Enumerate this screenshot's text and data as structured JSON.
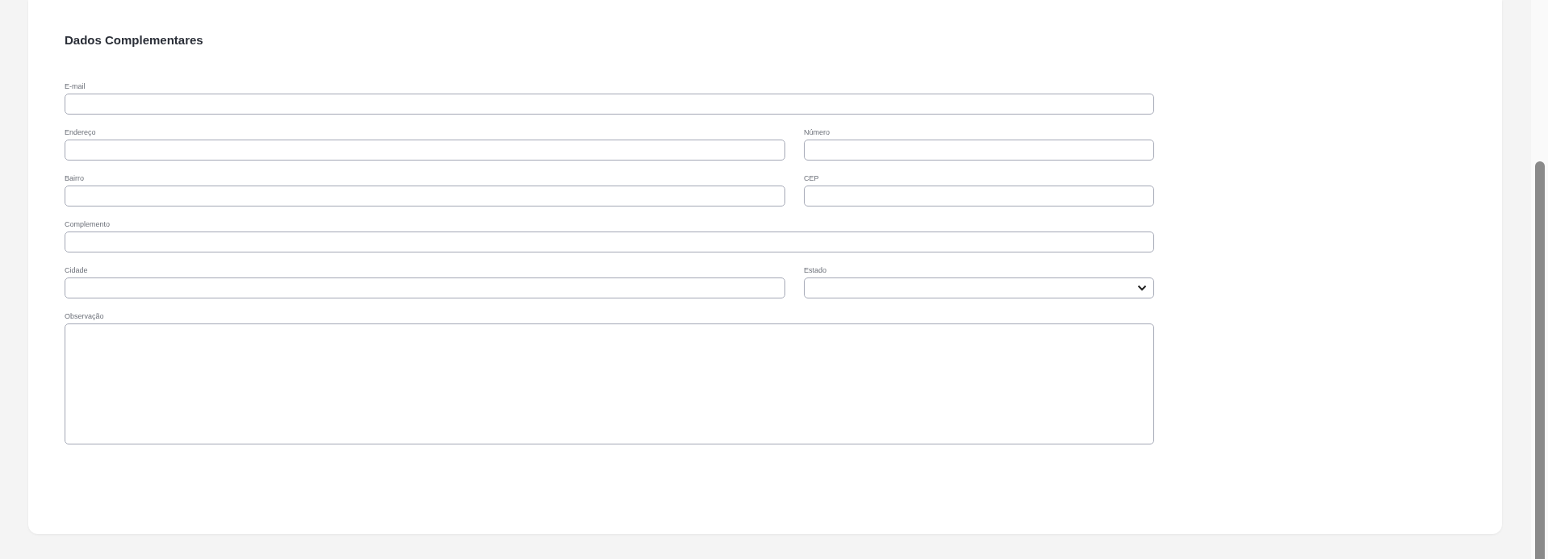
{
  "section": {
    "title": "Dados Complementares"
  },
  "rows": [
    {
      "fields": [
        {
          "label": "E-mail",
          "kind": "text"
        }
      ]
    },
    {
      "fields": [
        {
          "label": "Endereço",
          "kind": "text"
        },
        {
          "label": "Número",
          "kind": "text"
        }
      ]
    },
    {
      "fields": [
        {
          "label": "Bairro",
          "kind": "text"
        },
        {
          "label": "CEP",
          "kind": "text"
        }
      ]
    },
    {
      "fields": [
        {
          "label": "Complemento",
          "kind": "text"
        }
      ]
    },
    {
      "fields": [
        {
          "label": "Cidade",
          "kind": "text"
        },
        {
          "label": "Estado",
          "kind": "select"
        }
      ]
    },
    {
      "fields": [
        {
          "label": "Observação",
          "kind": "textarea"
        }
      ]
    }
  ]
}
